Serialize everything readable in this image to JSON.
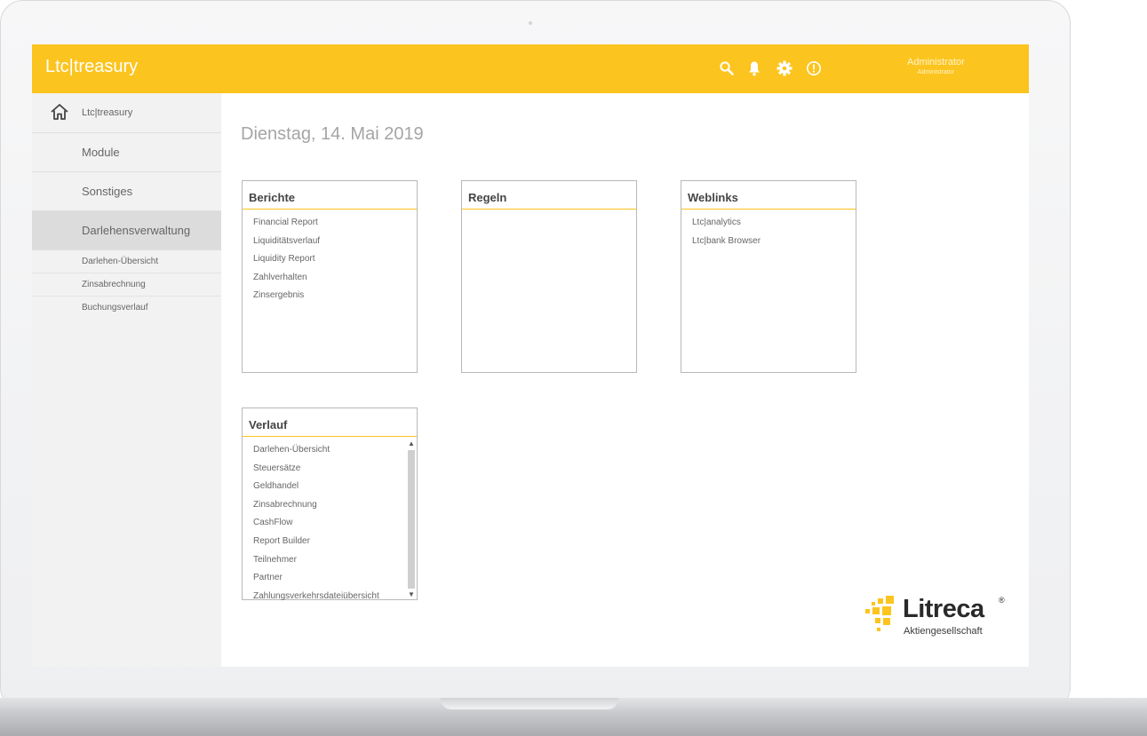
{
  "header": {
    "app_title": "Ltc|treasury",
    "icons": [
      "search-icon",
      "bell-icon",
      "gear-icon",
      "info-icon"
    ],
    "user_name": "Administrator",
    "user_role": "Administrator"
  },
  "sidebar": {
    "home_label": "Ltc|treasury",
    "items": [
      {
        "label": "Module"
      },
      {
        "label": "Sonstiges"
      },
      {
        "label": "Darlehensverwaltung",
        "active": true
      }
    ],
    "sub_items": [
      {
        "label": "Darlehen-Übersicht"
      },
      {
        "label": "Zinsabrechnung"
      },
      {
        "label": "Buchungsverlauf"
      }
    ]
  },
  "main": {
    "date": "Dienstag, 14. Mai 2019",
    "widgets": {
      "berichte": {
        "title": "Berichte",
        "items": [
          "Financial Report",
          "Liquiditätsverlauf",
          "Liquidity Report",
          "Zahlverhalten",
          "Zinsergebnis"
        ]
      },
      "regeln": {
        "title": "Regeln",
        "items": []
      },
      "weblinks": {
        "title": "Weblinks",
        "items": [
          "Ltc|analytics",
          "Ltc|bank Browser"
        ]
      },
      "verlauf": {
        "title": "Verlauf",
        "items": [
          "Darlehen-Übersicht",
          "Steuersätze",
          "Geldhandel",
          "Zinsabrechnung",
          "CashFlow",
          "Report Builder",
          "Teilnehmer",
          "Partner",
          "Zahlungsverkehrsdateiübersicht"
        ]
      }
    }
  },
  "logo": {
    "name": "Litreca",
    "registered": "®",
    "subtitle": "Aktiengesellschaft"
  },
  "colors": {
    "accent": "#fcc41e",
    "sidebar_bg": "#f2f2f2",
    "sidebar_active": "#dcdcdc"
  }
}
